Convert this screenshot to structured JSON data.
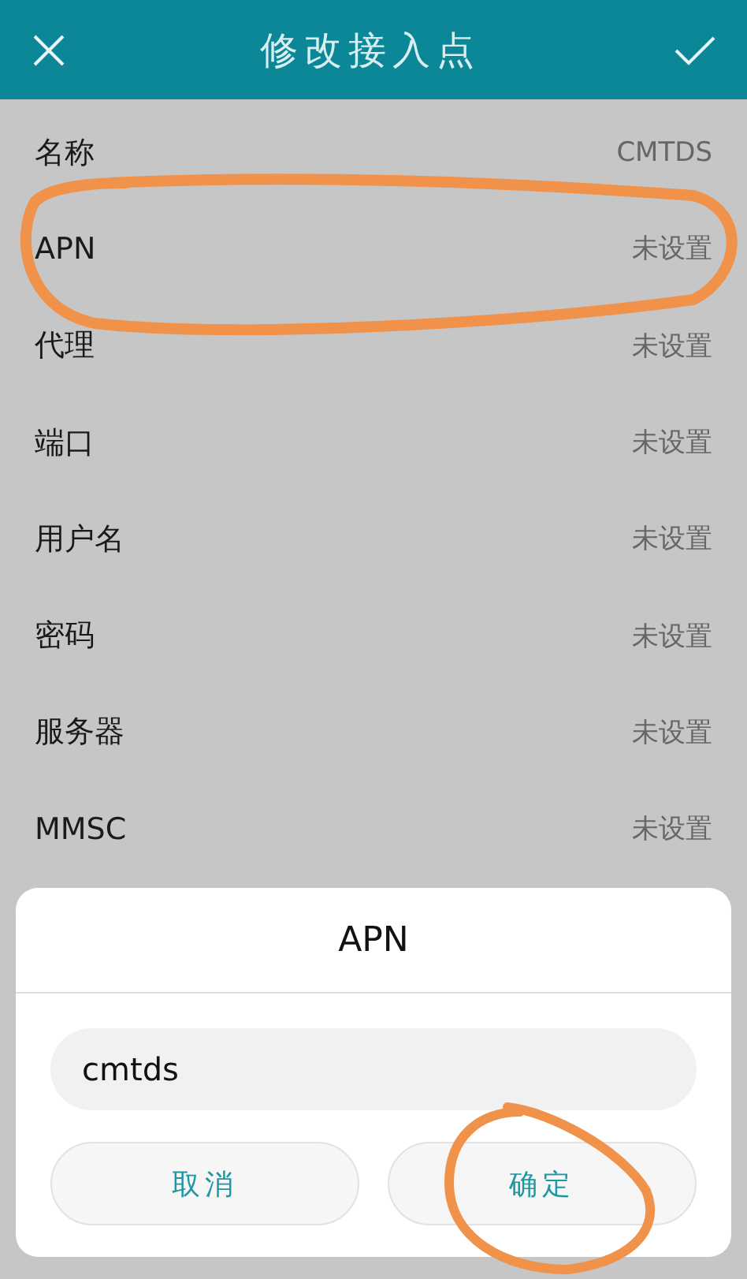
{
  "header": {
    "title": "修改接入点"
  },
  "fields": [
    {
      "label": "名称",
      "value": "CMTDS"
    },
    {
      "label": "APN",
      "value": "未设置"
    },
    {
      "label": "代理",
      "value": "未设置"
    },
    {
      "label": "端口",
      "value": "未设置"
    },
    {
      "label": "用户名",
      "value": "未设置"
    },
    {
      "label": "密码",
      "value": "未设置"
    },
    {
      "label": "服务器",
      "value": "未设置"
    },
    {
      "label": "MMSC",
      "value": "未设置"
    }
  ],
  "dialog": {
    "title": "APN",
    "value": "cmtds",
    "buttons": [
      "取消",
      "确定"
    ]
  }
}
